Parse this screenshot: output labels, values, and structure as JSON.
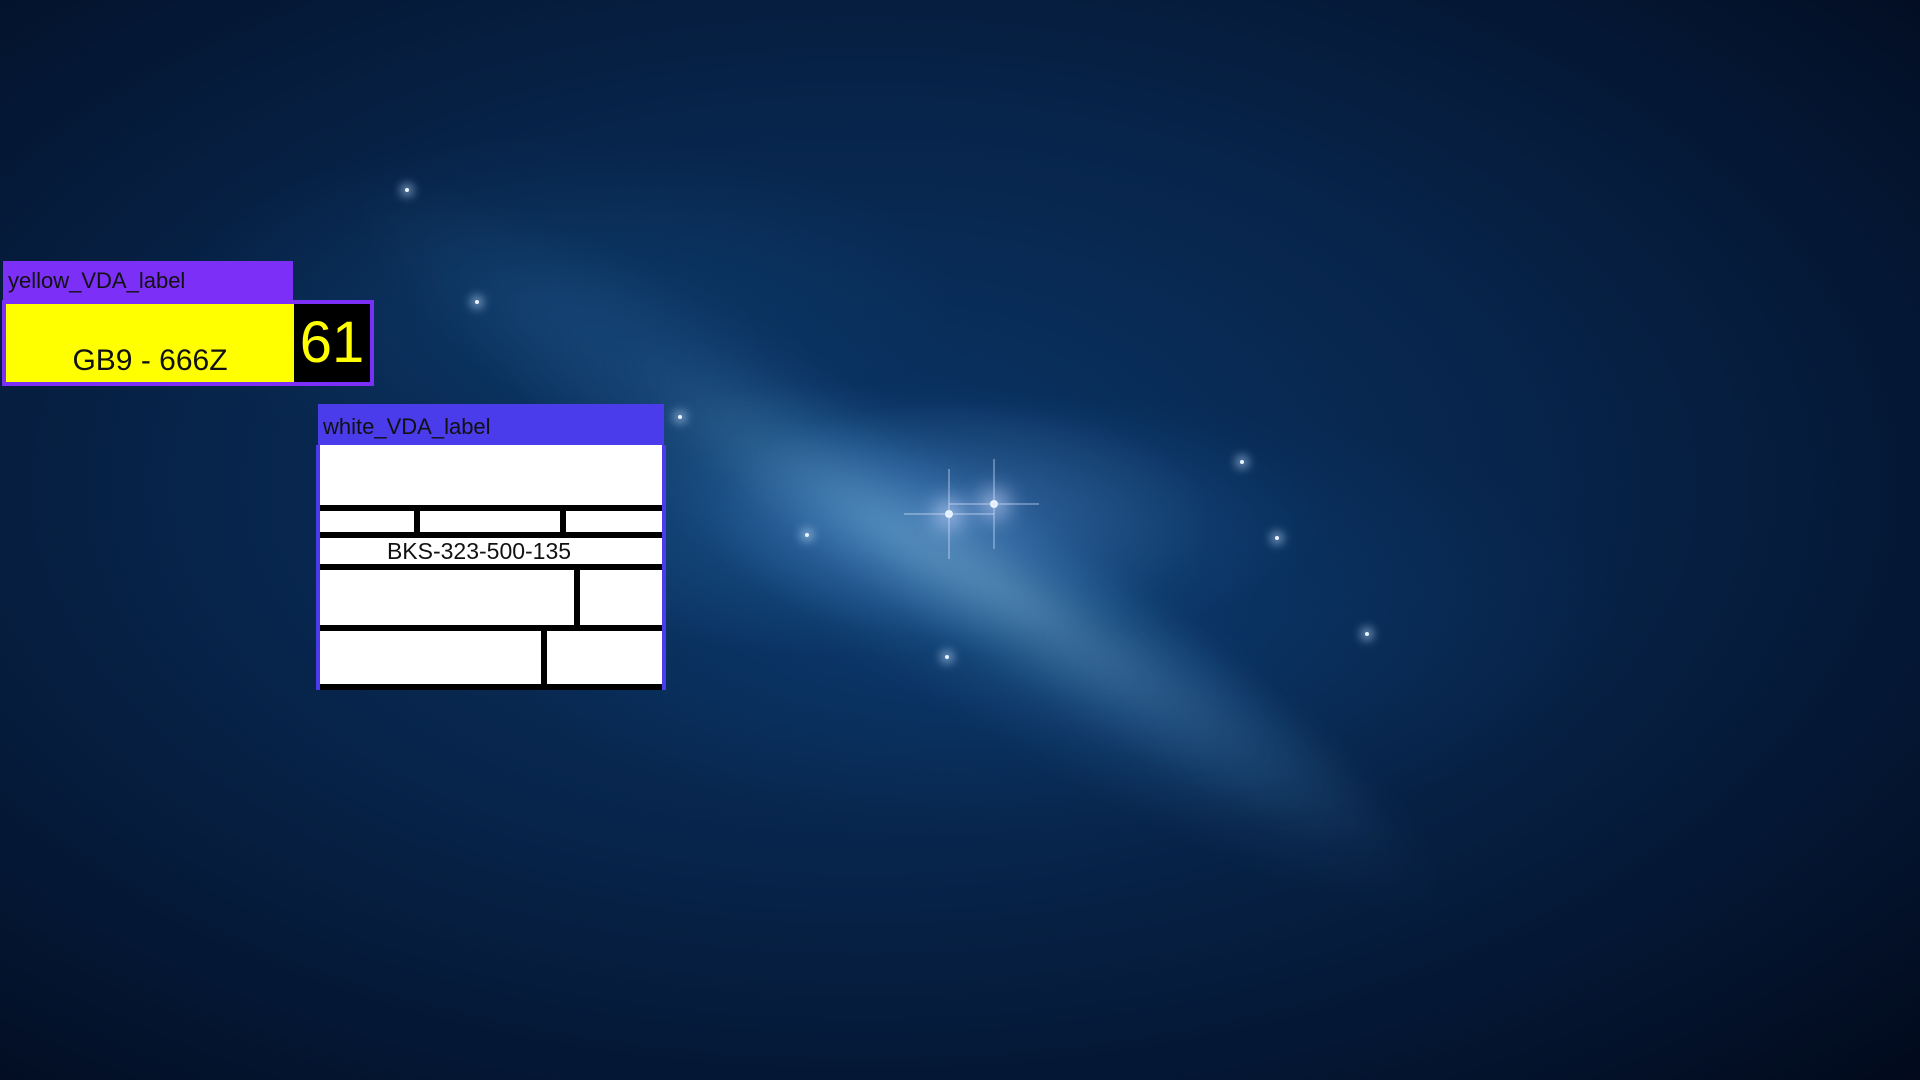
{
  "background": {
    "description_icon": "galaxy-wallpaper",
    "colors": {
      "deep": "#041632",
      "mid": "#0a3566",
      "nebula": "#78bee6"
    }
  },
  "yellow_widget": {
    "title": "yellow_VDA_label",
    "plate_text": "GB9 - 666Z",
    "number": "61",
    "colors": {
      "frame": "#7b2ff7",
      "plate": "#ffff00",
      "number_bg": "#000000",
      "number_fg": "#ffff00"
    }
  },
  "white_widget": {
    "title": "white_VDA_label",
    "code": "BKS-323-500-135",
    "colors": {
      "frame": "#4a3cea",
      "label_bg": "#ffffff",
      "lines": "#000000"
    }
  }
}
